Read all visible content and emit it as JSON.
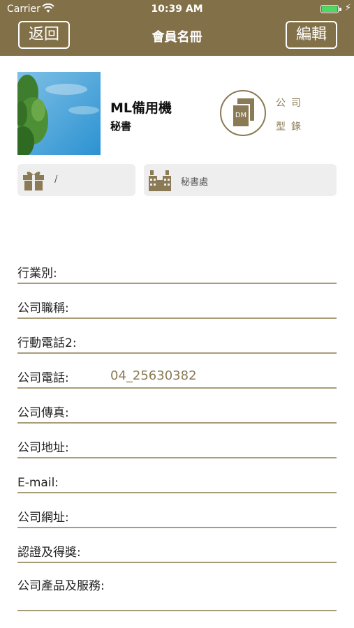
{
  "status_bar": {
    "carrier": "Carrier",
    "time": "10:39 AM",
    "battery_icon": "battery-icon",
    "wifi_icon": "wifi-icon",
    "charging_icon": "charging-bolt-icon"
  },
  "nav": {
    "title": "會員名冊",
    "back_label": "返回",
    "edit_label": "編輯",
    "bar_color": "#827048"
  },
  "profile": {
    "name": "ML備用機",
    "role": "秘書",
    "photo_icon": "profile-photo"
  },
  "catalog": {
    "dm_label": "DM",
    "line1": "公司",
    "line2": "型錄",
    "accent_color": "#8a7a55"
  },
  "info_boxes": {
    "gift_text": "/",
    "building_text": "秘書處"
  },
  "fields": [
    {
      "label": "行業別:",
      "value": ""
    },
    {
      "label": "公司職稱:",
      "value": ""
    },
    {
      "label": "行動電話2:",
      "value": ""
    },
    {
      "label": "公司電話:",
      "value": "04_25630382"
    },
    {
      "label": "公司傳真:",
      "value": ""
    },
    {
      "label": "公司地址:",
      "value": ""
    },
    {
      "label": "E-mail:",
      "value": ""
    },
    {
      "label": "公司網址:",
      "value": ""
    },
    {
      "label": "認證及得獎:",
      "value": ""
    },
    {
      "label": "公司產品及服務:",
      "value": ""
    }
  ]
}
